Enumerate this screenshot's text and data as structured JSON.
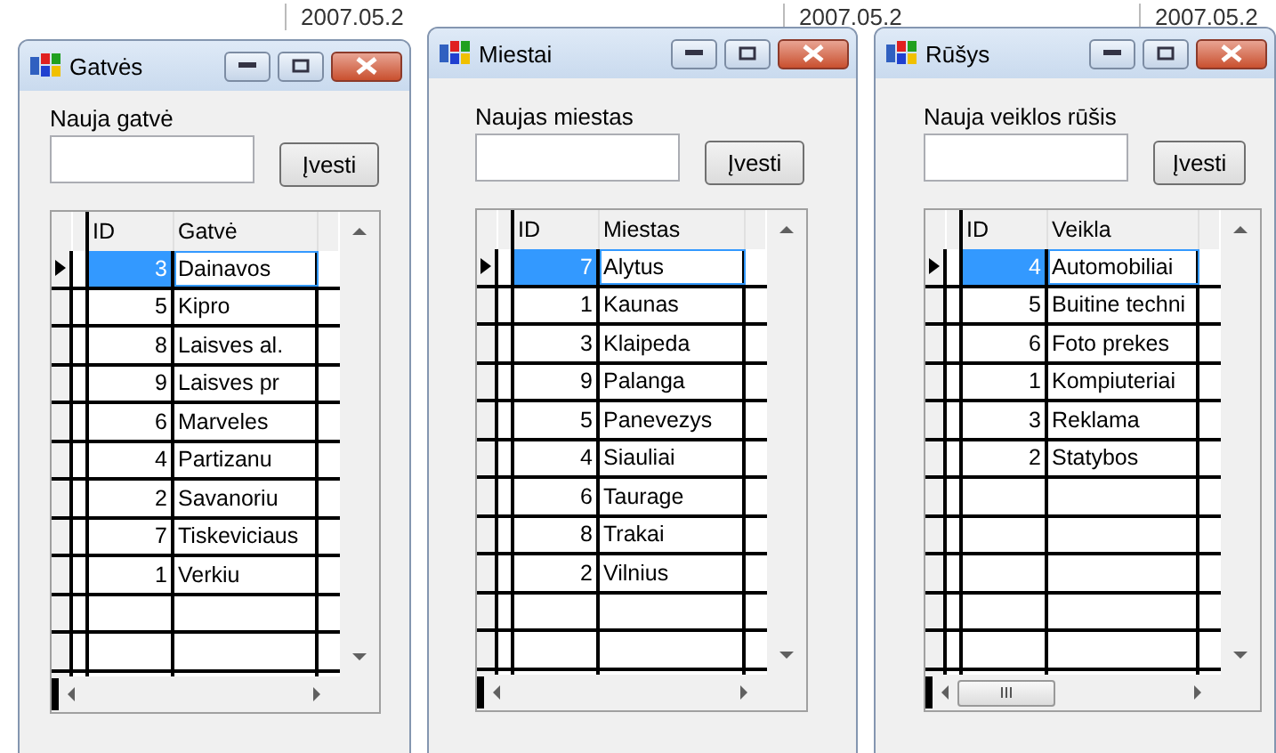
{
  "background": {
    "dates": [
      "2007.05.2",
      "2007.05.2",
      "2007.05.2"
    ]
  },
  "windows": [
    {
      "title": "Gatvės",
      "field_label": "Nauja gatvė",
      "button": "Įvesti",
      "columns": [
        "ID",
        "Gatvė"
      ],
      "hscroll_thumb": false,
      "rows": [
        {
          "id": "3",
          "name": "Dainavos",
          "selected": true
        },
        {
          "id": "5",
          "name": "Kipro",
          "selected": false
        },
        {
          "id": "8",
          "name": "Laisves al.",
          "selected": false
        },
        {
          "id": "9",
          "name": "Laisves pr",
          "selected": false
        },
        {
          "id": "6",
          "name": "Marveles",
          "selected": false
        },
        {
          "id": "4",
          "name": "Partizanu",
          "selected": false
        },
        {
          "id": "2",
          "name": "Savanoriu",
          "selected": false
        },
        {
          "id": "7",
          "name": "Tiskeviciaus",
          "selected": false
        },
        {
          "id": "1",
          "name": "Verkiu",
          "selected": false
        }
      ]
    },
    {
      "title": "Miestai",
      "field_label": "Naujas miestas",
      "button": "Įvesti",
      "columns": [
        "ID",
        "Miestas"
      ],
      "hscroll_thumb": false,
      "rows": [
        {
          "id": "7",
          "name": "Alytus",
          "selected": true
        },
        {
          "id": "1",
          "name": "Kaunas",
          "selected": false
        },
        {
          "id": "3",
          "name": "Klaipeda",
          "selected": false
        },
        {
          "id": "9",
          "name": "Palanga",
          "selected": false
        },
        {
          "id": "5",
          "name": "Panevezys",
          "selected": false
        },
        {
          "id": "4",
          "name": "Siauliai",
          "selected": false
        },
        {
          "id": "6",
          "name": "Taurage",
          "selected": false
        },
        {
          "id": "8",
          "name": "Trakai",
          "selected": false
        },
        {
          "id": "2",
          "name": "Vilnius",
          "selected": false
        }
      ]
    },
    {
      "title": "Rūšys",
      "field_label": "Nauja veiklos rūšis",
      "button": "Įvesti",
      "columns": [
        "ID",
        "Veikla"
      ],
      "hscroll_thumb": true,
      "rows": [
        {
          "id": "4",
          "name": "Automobiliai",
          "selected": true
        },
        {
          "id": "5",
          "name": "Buitine techni",
          "selected": false
        },
        {
          "id": "6",
          "name": "Foto prekes",
          "selected": false
        },
        {
          "id": "1",
          "name": "Kompiuteriai",
          "selected": false
        },
        {
          "id": "3",
          "name": "Reklama",
          "selected": false
        },
        {
          "id": "2",
          "name": "Statybos",
          "selected": false
        }
      ]
    }
  ]
}
